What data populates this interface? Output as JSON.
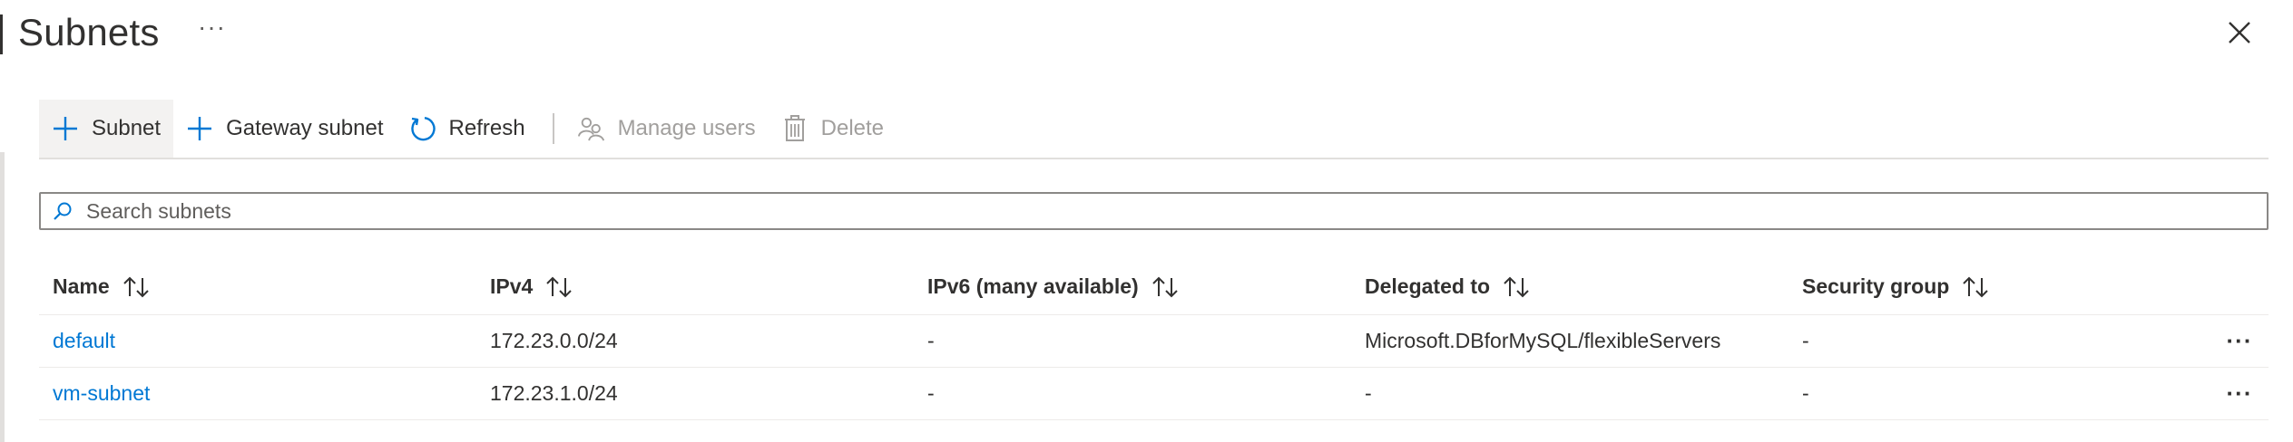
{
  "title": "Subnets",
  "title_more": "···",
  "toolbar": {
    "add_subnet": "Subnet",
    "gateway_subnet": "Gateway subnet",
    "refresh": "Refresh",
    "manage_users": "Manage users",
    "delete": "Delete"
  },
  "search": {
    "placeholder": "Search subnets",
    "value": ""
  },
  "table": {
    "columns": [
      "Name",
      "IPv4",
      "IPv6 (many available)",
      "Delegated to",
      "Security group"
    ],
    "rows": [
      {
        "name": "default",
        "ipv4": "172.23.0.0/24",
        "ipv6": "-",
        "delegated": "Microsoft.DBforMySQL/flexibleServers",
        "security_group": "-",
        "more": "···"
      },
      {
        "name": "vm-subnet",
        "ipv4": "172.23.1.0/24",
        "ipv6": "-",
        "delegated": "-",
        "security_group": "-",
        "more": "···"
      }
    ]
  },
  "colors": {
    "accent": "#0078d4",
    "text": "#323130",
    "disabled": "#a19f9d",
    "border": "#edebe9"
  },
  "icons": {
    "add": "plus-icon",
    "refresh": "refresh-icon",
    "manage_users": "people-icon",
    "delete": "trash-icon",
    "search": "search-icon",
    "sort": "sort-arrows-icon",
    "close": "close-icon",
    "more": "more-icon"
  }
}
